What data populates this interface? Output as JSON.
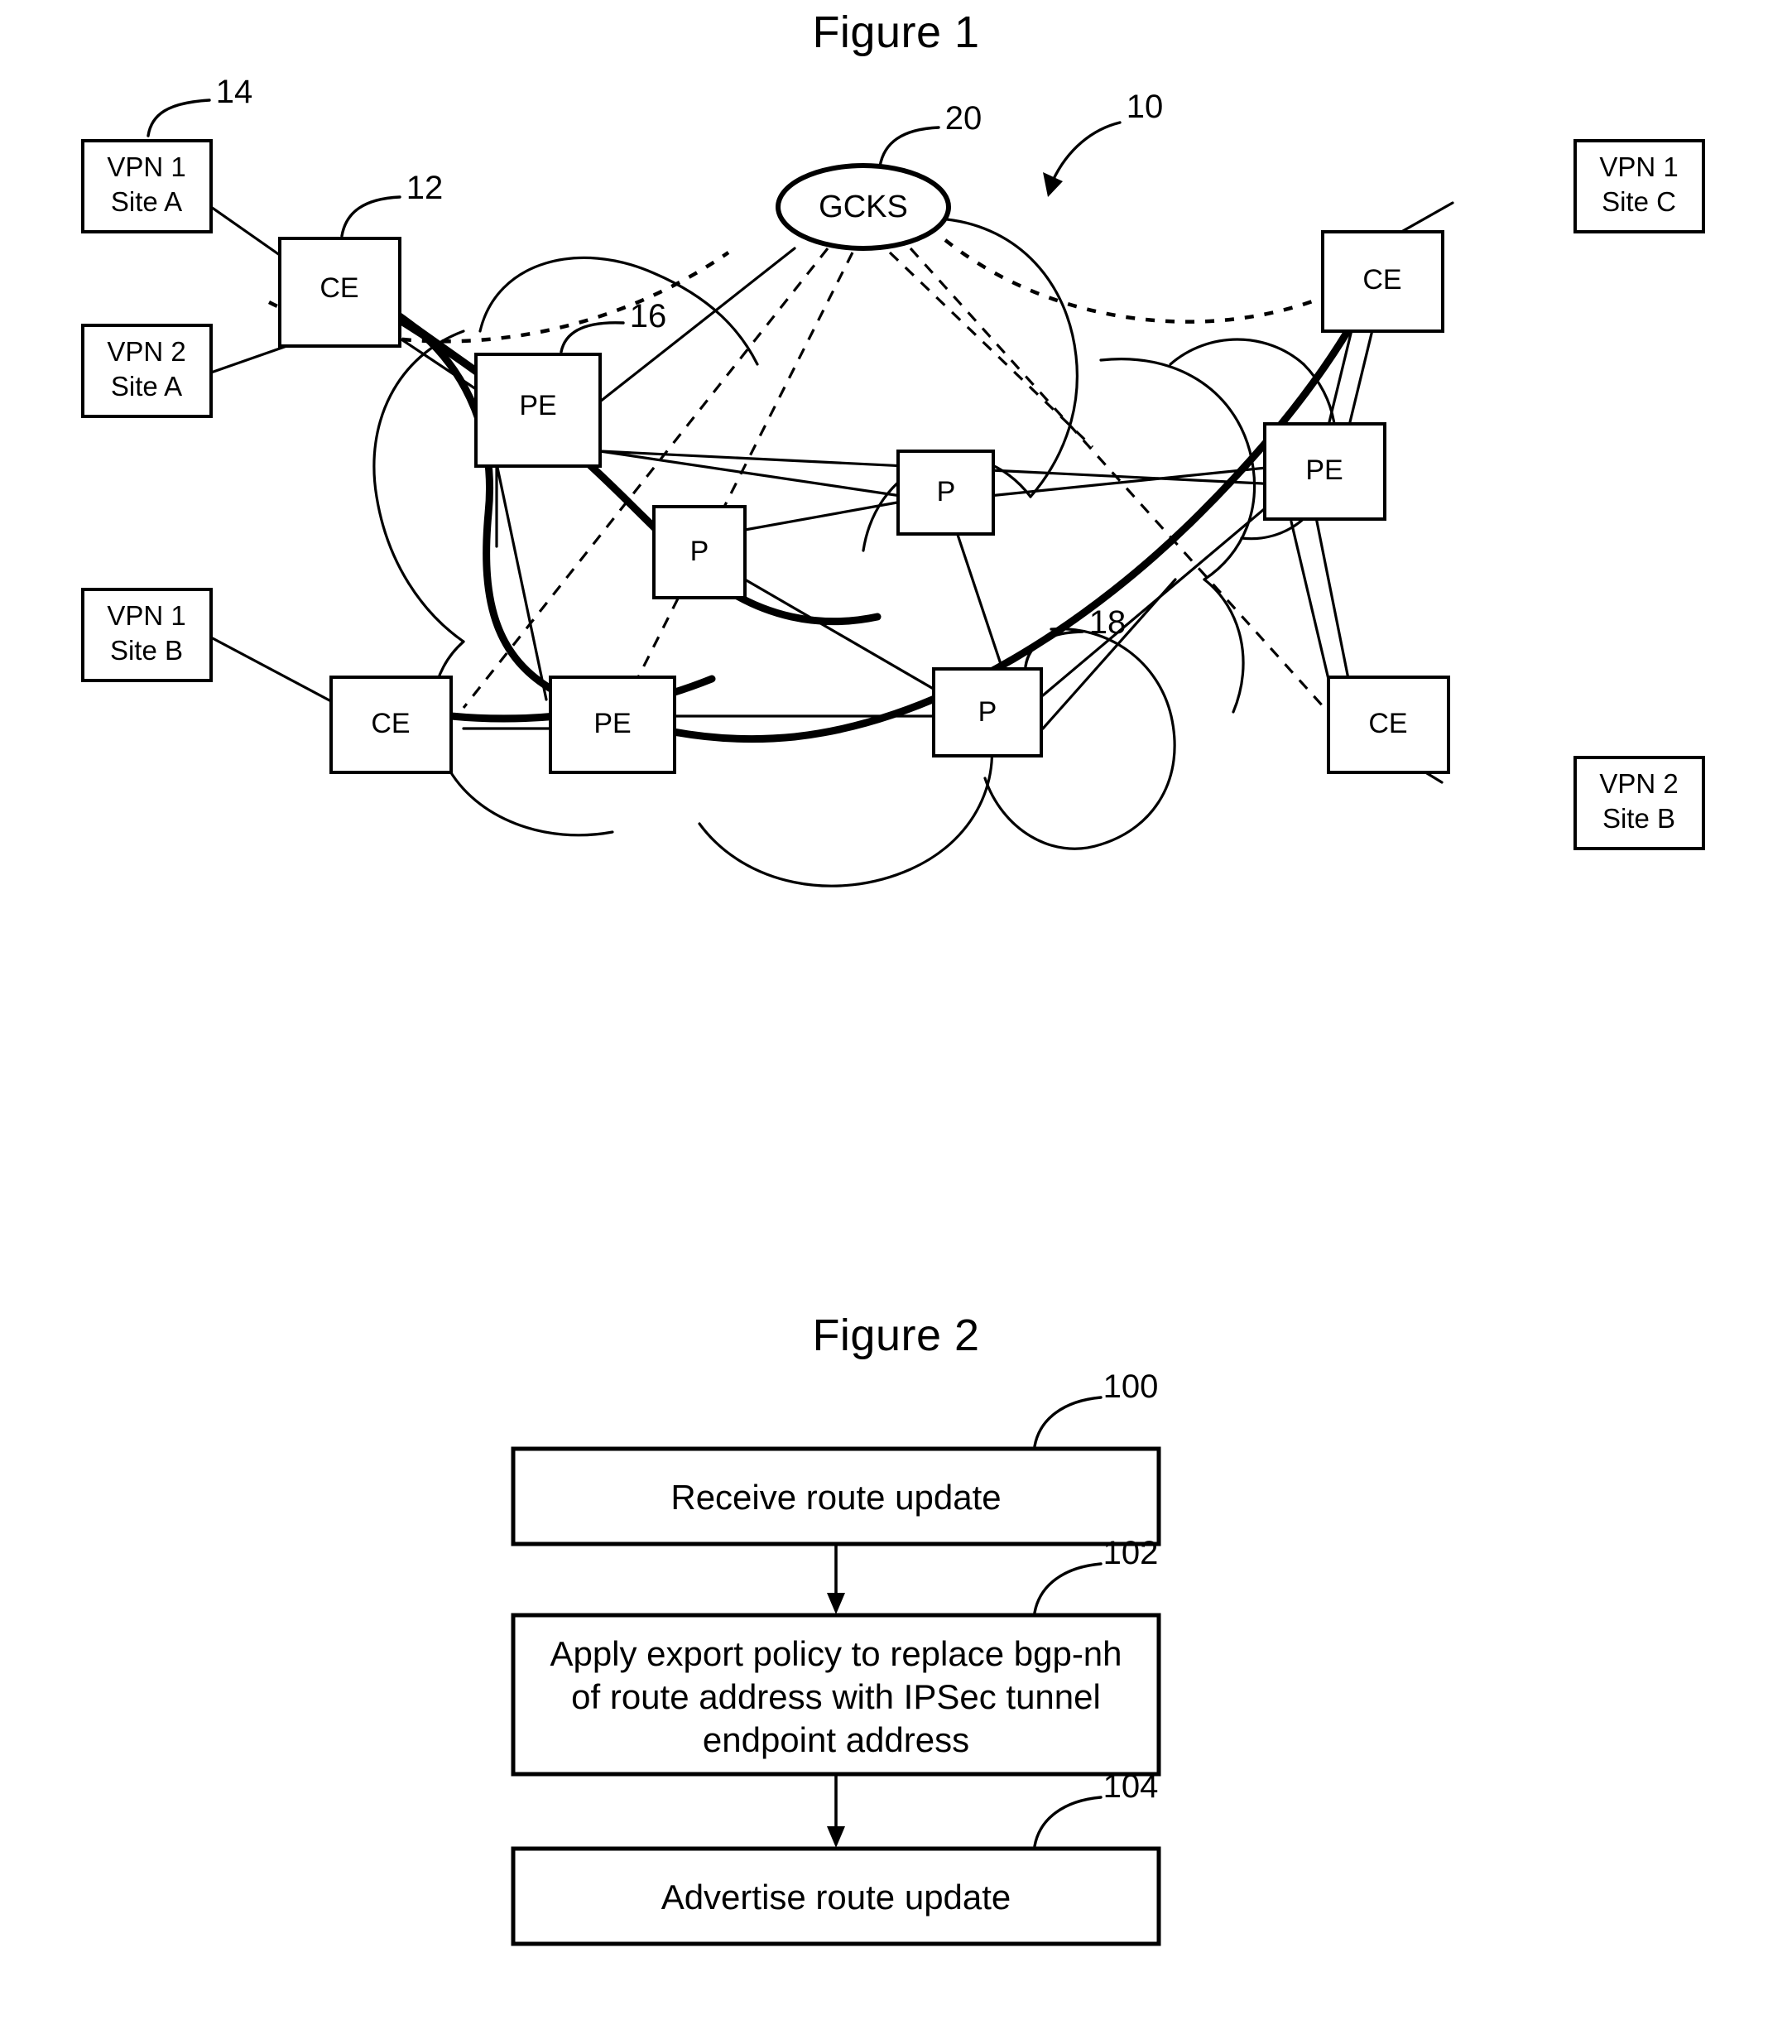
{
  "figures": [
    {
      "title": "Figure 1",
      "type": "network-diagram",
      "nodes": {
        "vpn1_site_a_l1": "VPN 1",
        "vpn1_site_a_l2": "Site A",
        "vpn2_site_a_l1": "VPN 2",
        "vpn2_site_a_l2": "Site A",
        "vpn1_site_b_l1": "VPN 1",
        "vpn1_site_b_l2": "Site B",
        "vpn1_site_c_l1": "VPN 1",
        "vpn1_site_c_l2": "Site C",
        "vpn2_site_b_l1": "VPN 2",
        "vpn2_site_b_l2": "Site B",
        "ce_top_left": "CE",
        "ce_bottom_left": "CE",
        "ce_top_right": "CE",
        "ce_bottom_right": "CE",
        "pe_left": "PE",
        "pe_bottom_left": "PE",
        "pe_right": "PE",
        "p_left": "P",
        "p_center": "P",
        "p_bottom": "P",
        "gcks": "GCKS"
      },
      "reference_numerals": {
        "system": "10",
        "ce_router": "12",
        "vpn_site": "14",
        "pe_router": "16",
        "p_router": "18",
        "gcks": "20"
      }
    },
    {
      "title": "Figure 2",
      "type": "flowchart",
      "steps": [
        {
          "ref": "100",
          "text": "Receive route update"
        },
        {
          "ref": "102",
          "text_line1": "Apply export policy to replace bgp-nh",
          "text_line2": "of route address with IPSec tunnel",
          "text_line3": "endpoint address"
        },
        {
          "ref": "104",
          "text": "Advertise route update"
        }
      ]
    }
  ]
}
